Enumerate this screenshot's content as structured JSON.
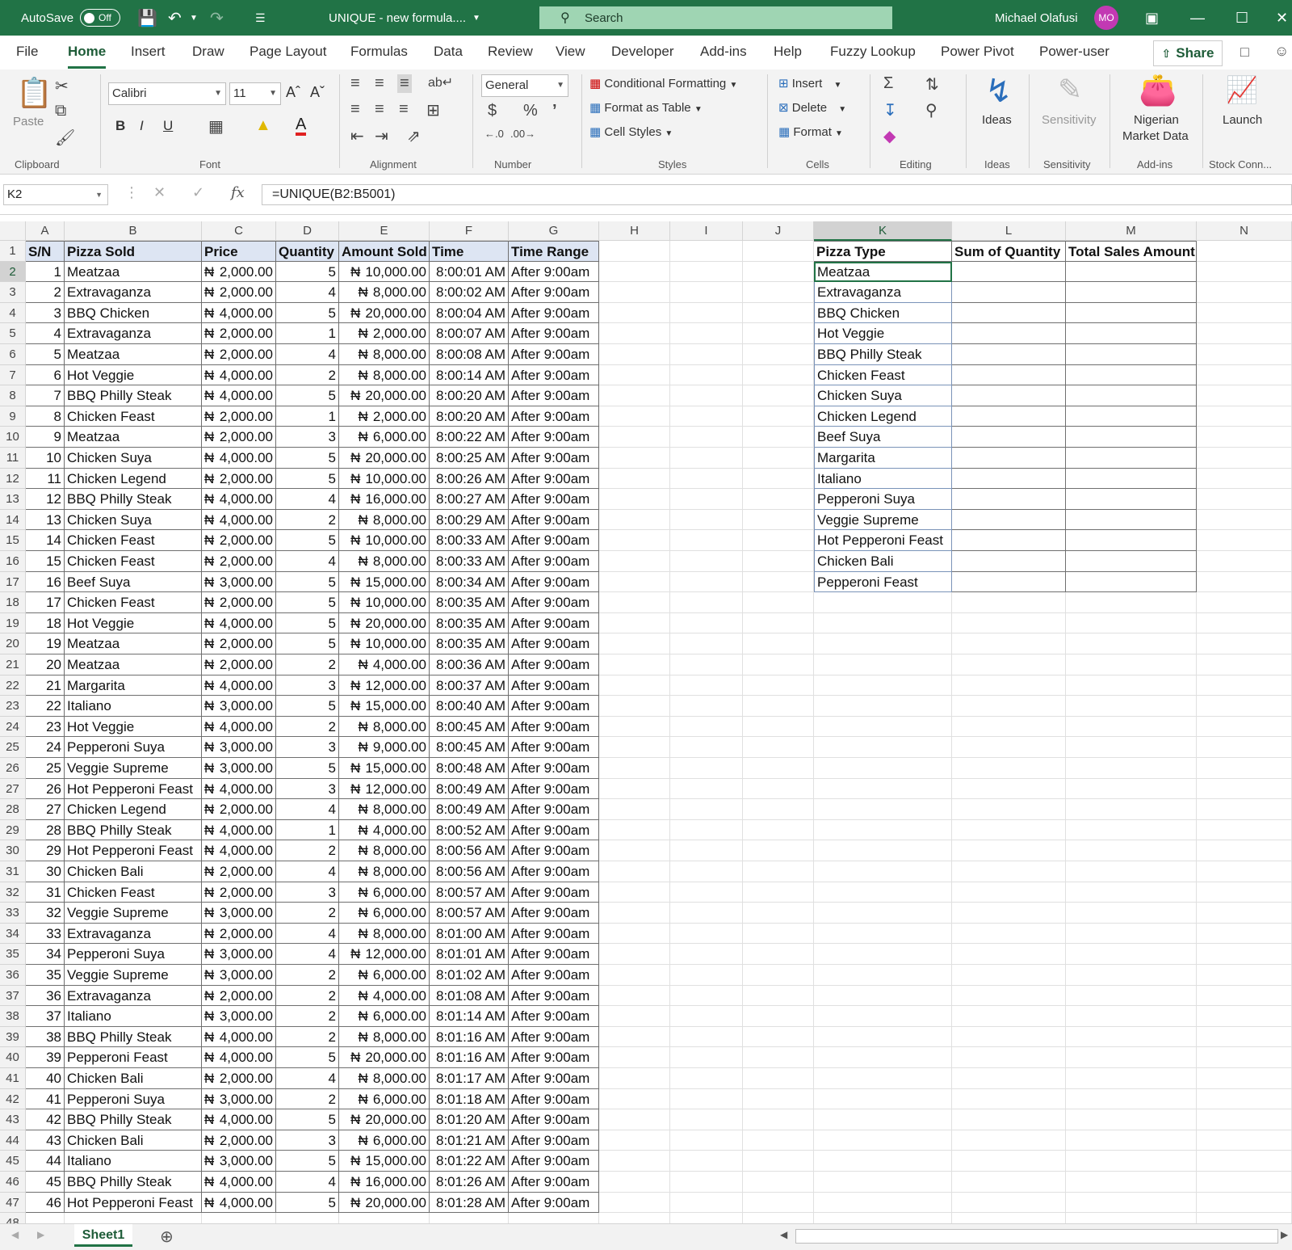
{
  "titlebar": {
    "autosave_label": "AutoSave",
    "autosave_state": "Off",
    "doc_title": "UNIQUE - new formula....",
    "search_placeholder": "Search",
    "user_name": "Michael Olafusi",
    "user_initials": "MO"
  },
  "menu": {
    "tabs": [
      "File",
      "Home",
      "Insert",
      "Draw",
      "Page Layout",
      "Formulas",
      "Data",
      "Review",
      "View",
      "Developer",
      "Add-ins",
      "Help",
      "Fuzzy Lookup",
      "Power Pivot",
      "Power-user"
    ],
    "active": "Home",
    "share_label": "Share"
  },
  "ribbon": {
    "paste_label": "Paste",
    "font_name": "Calibri",
    "font_size": "11",
    "number_format": "General",
    "conditional_formatting": "Conditional Formatting",
    "format_as_table": "Format as Table",
    "cell_styles": "Cell Styles",
    "insert": "Insert",
    "delete": "Delete",
    "format": "Format",
    "ideas": "Ideas",
    "sensitivity": "Sensitivity",
    "nigerian_market_data_1": "Nigerian",
    "nigerian_market_data_2": "Market Data",
    "launch": "Launch",
    "groups": {
      "clipboard": "Clipboard",
      "font": "Font",
      "alignment": "Alignment",
      "number": "Number",
      "styles": "Styles",
      "cells": "Cells",
      "editing": "Editing",
      "ideas": "Ideas",
      "sensitivity": "Sensitivity",
      "addins": "Add-ins",
      "stock": "Stock Conn..."
    }
  },
  "formula_bar": {
    "name_box": "K2",
    "formula": "=UNIQUE(B2:B5001)"
  },
  "columns": [
    "A",
    "B",
    "C",
    "D",
    "E",
    "F",
    "G",
    "H",
    "I",
    "J",
    "K",
    "L",
    "M",
    "N"
  ],
  "selected_column": "K",
  "selected_row": 2,
  "table_headers": [
    "S/N",
    "Pizza Sold",
    "Price",
    "Quantity",
    "Amount Sold",
    "Time",
    "Time Range"
  ],
  "currency_symbol": "₦",
  "rows": [
    [
      "1",
      "Meatzaa",
      "2,000.00",
      "5",
      "10,000.00",
      "8:00:01 AM",
      "After 9:00am"
    ],
    [
      "2",
      "Extravaganza",
      "2,000.00",
      "4",
      "8,000.00",
      "8:00:02 AM",
      "After 9:00am"
    ],
    [
      "3",
      "BBQ Chicken",
      "4,000.00",
      "5",
      "20,000.00",
      "8:00:04 AM",
      "After 9:00am"
    ],
    [
      "4",
      "Extravaganza",
      "2,000.00",
      "1",
      "2,000.00",
      "8:00:07 AM",
      "After 9:00am"
    ],
    [
      "5",
      "Meatzaa",
      "2,000.00",
      "4",
      "8,000.00",
      "8:00:08 AM",
      "After 9:00am"
    ],
    [
      "6",
      "Hot Veggie",
      "4,000.00",
      "2",
      "8,000.00",
      "8:00:14 AM",
      "After 9:00am"
    ],
    [
      "7",
      "BBQ Philly Steak",
      "4,000.00",
      "5",
      "20,000.00",
      "8:00:20 AM",
      "After 9:00am"
    ],
    [
      "8",
      "Chicken Feast",
      "2,000.00",
      "1",
      "2,000.00",
      "8:00:20 AM",
      "After 9:00am"
    ],
    [
      "9",
      "Meatzaa",
      "2,000.00",
      "3",
      "6,000.00",
      "8:00:22 AM",
      "After 9:00am"
    ],
    [
      "10",
      "Chicken Suya",
      "4,000.00",
      "5",
      "20,000.00",
      "8:00:25 AM",
      "After 9:00am"
    ],
    [
      "11",
      "Chicken Legend",
      "2,000.00",
      "5",
      "10,000.00",
      "8:00:26 AM",
      "After 9:00am"
    ],
    [
      "12",
      "BBQ Philly Steak",
      "4,000.00",
      "4",
      "16,000.00",
      "8:00:27 AM",
      "After 9:00am"
    ],
    [
      "13",
      "Chicken Suya",
      "4,000.00",
      "2",
      "8,000.00",
      "8:00:29 AM",
      "After 9:00am"
    ],
    [
      "14",
      "Chicken Feast",
      "2,000.00",
      "5",
      "10,000.00",
      "8:00:33 AM",
      "After 9:00am"
    ],
    [
      "15",
      "Chicken Feast",
      "2,000.00",
      "4",
      "8,000.00",
      "8:00:33 AM",
      "After 9:00am"
    ],
    [
      "16",
      "Beef Suya",
      "3,000.00",
      "5",
      "15,000.00",
      "8:00:34 AM",
      "After 9:00am"
    ],
    [
      "17",
      "Chicken Feast",
      "2,000.00",
      "5",
      "10,000.00",
      "8:00:35 AM",
      "After 9:00am"
    ],
    [
      "18",
      "Hot Veggie",
      "4,000.00",
      "5",
      "20,000.00",
      "8:00:35 AM",
      "After 9:00am"
    ],
    [
      "19",
      "Meatzaa",
      "2,000.00",
      "5",
      "10,000.00",
      "8:00:35 AM",
      "After 9:00am"
    ],
    [
      "20",
      "Meatzaa",
      "2,000.00",
      "2",
      "4,000.00",
      "8:00:36 AM",
      "After 9:00am"
    ],
    [
      "21",
      "Margarita",
      "4,000.00",
      "3",
      "12,000.00",
      "8:00:37 AM",
      "After 9:00am"
    ],
    [
      "22",
      "Italiano",
      "3,000.00",
      "5",
      "15,000.00",
      "8:00:40 AM",
      "After 9:00am"
    ],
    [
      "23",
      "Hot Veggie",
      "4,000.00",
      "2",
      "8,000.00",
      "8:00:45 AM",
      "After 9:00am"
    ],
    [
      "24",
      "Pepperoni Suya",
      "3,000.00",
      "3",
      "9,000.00",
      "8:00:45 AM",
      "After 9:00am"
    ],
    [
      "25",
      "Veggie Supreme",
      "3,000.00",
      "5",
      "15,000.00",
      "8:00:48 AM",
      "After 9:00am"
    ],
    [
      "26",
      "Hot Pepperoni Feast",
      "4,000.00",
      "3",
      "12,000.00",
      "8:00:49 AM",
      "After 9:00am"
    ],
    [
      "27",
      "Chicken Legend",
      "2,000.00",
      "4",
      "8,000.00",
      "8:00:49 AM",
      "After 9:00am"
    ],
    [
      "28",
      "BBQ Philly Steak",
      "4,000.00",
      "1",
      "4,000.00",
      "8:00:52 AM",
      "After 9:00am"
    ],
    [
      "29",
      "Hot Pepperoni Feast",
      "4,000.00",
      "2",
      "8,000.00",
      "8:00:56 AM",
      "After 9:00am"
    ],
    [
      "30",
      "Chicken Bali",
      "2,000.00",
      "4",
      "8,000.00",
      "8:00:56 AM",
      "After 9:00am"
    ],
    [
      "31",
      "Chicken Feast",
      "2,000.00",
      "3",
      "6,000.00",
      "8:00:57 AM",
      "After 9:00am"
    ],
    [
      "32",
      "Veggie Supreme",
      "3,000.00",
      "2",
      "6,000.00",
      "8:00:57 AM",
      "After 9:00am"
    ],
    [
      "33",
      "Extravaganza",
      "2,000.00",
      "4",
      "8,000.00",
      "8:01:00 AM",
      "After 9:00am"
    ],
    [
      "34",
      "Pepperoni Suya",
      "3,000.00",
      "4",
      "12,000.00",
      "8:01:01 AM",
      "After 9:00am"
    ],
    [
      "35",
      "Veggie Supreme",
      "3,000.00",
      "2",
      "6,000.00",
      "8:01:02 AM",
      "After 9:00am"
    ],
    [
      "36",
      "Extravaganza",
      "2,000.00",
      "2",
      "4,000.00",
      "8:01:08 AM",
      "After 9:00am"
    ],
    [
      "37",
      "Italiano",
      "3,000.00",
      "2",
      "6,000.00",
      "8:01:14 AM",
      "After 9:00am"
    ],
    [
      "38",
      "BBQ Philly Steak",
      "4,000.00",
      "2",
      "8,000.00",
      "8:01:16 AM",
      "After 9:00am"
    ],
    [
      "39",
      "Pepperoni Feast",
      "4,000.00",
      "5",
      "20,000.00",
      "8:01:16 AM",
      "After 9:00am"
    ],
    [
      "40",
      "Chicken Bali",
      "2,000.00",
      "4",
      "8,000.00",
      "8:01:17 AM",
      "After 9:00am"
    ],
    [
      "41",
      "Pepperoni Suya",
      "3,000.00",
      "2",
      "6,000.00",
      "8:01:18 AM",
      "After 9:00am"
    ],
    [
      "42",
      "BBQ Philly Steak",
      "4,000.00",
      "5",
      "20,000.00",
      "8:01:20 AM",
      "After 9:00am"
    ],
    [
      "43",
      "Chicken Bali",
      "2,000.00",
      "3",
      "6,000.00",
      "8:01:21 AM",
      "After 9:00am"
    ],
    [
      "44",
      "Italiano",
      "3,000.00",
      "5",
      "15,000.00",
      "8:01:22 AM",
      "After 9:00am"
    ],
    [
      "45",
      "BBQ Philly Steak",
      "4,000.00",
      "4",
      "16,000.00",
      "8:01:26 AM",
      "After 9:00am"
    ],
    [
      "46",
      "Hot Pepperoni Feast",
      "4,000.00",
      "5",
      "20,000.00",
      "8:01:28 AM",
      "After 9:00am"
    ]
  ],
  "summary_headers": [
    "Pizza Type",
    "Sum of Quantity",
    "Total Sales Amount"
  ],
  "pizza_types": [
    "Meatzaa",
    "Extravaganza",
    "BBQ Chicken",
    "Hot Veggie",
    "BBQ Philly Steak",
    "Chicken Feast",
    "Chicken Suya",
    "Chicken Legend",
    "Beef Suya",
    "Margarita",
    "Italiano",
    "Pepperoni Suya",
    "Veggie Supreme",
    "Hot Pepperoni Feast",
    "Chicken Bali",
    "Pepperoni Feast"
  ],
  "sheet_tab": "Sheet1",
  "colors": {
    "excel_green": "#217346",
    "header_fill": "#dde5f3",
    "avatar": "#c239b3"
  }
}
